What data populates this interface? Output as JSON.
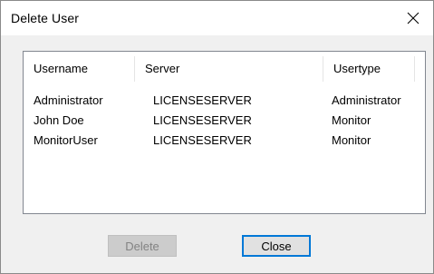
{
  "window": {
    "title": "Delete User"
  },
  "list": {
    "columns": [
      "Username",
      "Server",
      "Usertype"
    ],
    "rows": [
      [
        "Administrator",
        "LICENSESERVER",
        "Administrator"
      ],
      [
        "John Doe",
        "LICENSESERVER",
        "Monitor"
      ],
      [
        "MonitorUser",
        "LICENSESERVER",
        "Monitor"
      ]
    ]
  },
  "buttons": {
    "delete_label": "Delete",
    "delete_enabled": false,
    "close_label": "Close"
  },
  "colors": {
    "focus_border": "#0078d7",
    "disabled_text": "#838383"
  },
  "icons": {
    "close": "close-icon"
  }
}
